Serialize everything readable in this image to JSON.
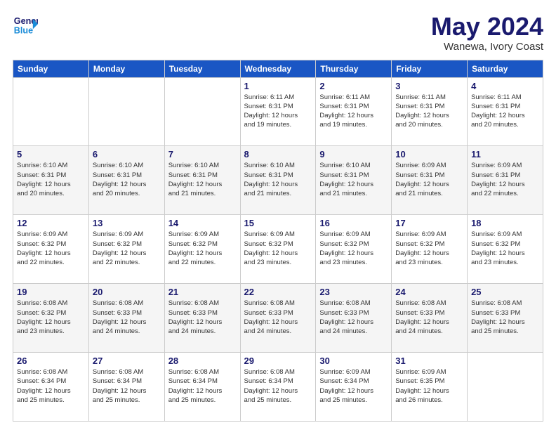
{
  "header": {
    "logo": {
      "line1": "General",
      "line2": "Blue"
    },
    "title": "May 2024",
    "location": "Wanewa, Ivory Coast"
  },
  "days_of_week": [
    "Sunday",
    "Monday",
    "Tuesday",
    "Wednesday",
    "Thursday",
    "Friday",
    "Saturday"
  ],
  "weeks": [
    [
      {
        "day": "",
        "info": ""
      },
      {
        "day": "",
        "info": ""
      },
      {
        "day": "",
        "info": ""
      },
      {
        "day": "1",
        "info": "Sunrise: 6:11 AM\nSunset: 6:31 PM\nDaylight: 12 hours\nand 19 minutes."
      },
      {
        "day": "2",
        "info": "Sunrise: 6:11 AM\nSunset: 6:31 PM\nDaylight: 12 hours\nand 19 minutes."
      },
      {
        "day": "3",
        "info": "Sunrise: 6:11 AM\nSunset: 6:31 PM\nDaylight: 12 hours\nand 20 minutes."
      },
      {
        "day": "4",
        "info": "Sunrise: 6:11 AM\nSunset: 6:31 PM\nDaylight: 12 hours\nand 20 minutes."
      }
    ],
    [
      {
        "day": "5",
        "info": "Sunrise: 6:10 AM\nSunset: 6:31 PM\nDaylight: 12 hours\nand 20 minutes."
      },
      {
        "day": "6",
        "info": "Sunrise: 6:10 AM\nSunset: 6:31 PM\nDaylight: 12 hours\nand 20 minutes."
      },
      {
        "day": "7",
        "info": "Sunrise: 6:10 AM\nSunset: 6:31 PM\nDaylight: 12 hours\nand 21 minutes."
      },
      {
        "day": "8",
        "info": "Sunrise: 6:10 AM\nSunset: 6:31 PM\nDaylight: 12 hours\nand 21 minutes."
      },
      {
        "day": "9",
        "info": "Sunrise: 6:10 AM\nSunset: 6:31 PM\nDaylight: 12 hours\nand 21 minutes."
      },
      {
        "day": "10",
        "info": "Sunrise: 6:09 AM\nSunset: 6:31 PM\nDaylight: 12 hours\nand 21 minutes."
      },
      {
        "day": "11",
        "info": "Sunrise: 6:09 AM\nSunset: 6:31 PM\nDaylight: 12 hours\nand 22 minutes."
      }
    ],
    [
      {
        "day": "12",
        "info": "Sunrise: 6:09 AM\nSunset: 6:32 PM\nDaylight: 12 hours\nand 22 minutes."
      },
      {
        "day": "13",
        "info": "Sunrise: 6:09 AM\nSunset: 6:32 PM\nDaylight: 12 hours\nand 22 minutes."
      },
      {
        "day": "14",
        "info": "Sunrise: 6:09 AM\nSunset: 6:32 PM\nDaylight: 12 hours\nand 22 minutes."
      },
      {
        "day": "15",
        "info": "Sunrise: 6:09 AM\nSunset: 6:32 PM\nDaylight: 12 hours\nand 23 minutes."
      },
      {
        "day": "16",
        "info": "Sunrise: 6:09 AM\nSunset: 6:32 PM\nDaylight: 12 hours\nand 23 minutes."
      },
      {
        "day": "17",
        "info": "Sunrise: 6:09 AM\nSunset: 6:32 PM\nDaylight: 12 hours\nand 23 minutes."
      },
      {
        "day": "18",
        "info": "Sunrise: 6:09 AM\nSunset: 6:32 PM\nDaylight: 12 hours\nand 23 minutes."
      }
    ],
    [
      {
        "day": "19",
        "info": "Sunrise: 6:08 AM\nSunset: 6:32 PM\nDaylight: 12 hours\nand 23 minutes."
      },
      {
        "day": "20",
        "info": "Sunrise: 6:08 AM\nSunset: 6:33 PM\nDaylight: 12 hours\nand 24 minutes."
      },
      {
        "day": "21",
        "info": "Sunrise: 6:08 AM\nSunset: 6:33 PM\nDaylight: 12 hours\nand 24 minutes."
      },
      {
        "day": "22",
        "info": "Sunrise: 6:08 AM\nSunset: 6:33 PM\nDaylight: 12 hours\nand 24 minutes."
      },
      {
        "day": "23",
        "info": "Sunrise: 6:08 AM\nSunset: 6:33 PM\nDaylight: 12 hours\nand 24 minutes."
      },
      {
        "day": "24",
        "info": "Sunrise: 6:08 AM\nSunset: 6:33 PM\nDaylight: 12 hours\nand 24 minutes."
      },
      {
        "day": "25",
        "info": "Sunrise: 6:08 AM\nSunset: 6:33 PM\nDaylight: 12 hours\nand 25 minutes."
      }
    ],
    [
      {
        "day": "26",
        "info": "Sunrise: 6:08 AM\nSunset: 6:34 PM\nDaylight: 12 hours\nand 25 minutes."
      },
      {
        "day": "27",
        "info": "Sunrise: 6:08 AM\nSunset: 6:34 PM\nDaylight: 12 hours\nand 25 minutes."
      },
      {
        "day": "28",
        "info": "Sunrise: 6:08 AM\nSunset: 6:34 PM\nDaylight: 12 hours\nand 25 minutes."
      },
      {
        "day": "29",
        "info": "Sunrise: 6:08 AM\nSunset: 6:34 PM\nDaylight: 12 hours\nand 25 minutes."
      },
      {
        "day": "30",
        "info": "Sunrise: 6:09 AM\nSunset: 6:34 PM\nDaylight: 12 hours\nand 25 minutes."
      },
      {
        "day": "31",
        "info": "Sunrise: 6:09 AM\nSunset: 6:35 PM\nDaylight: 12 hours\nand 26 minutes."
      },
      {
        "day": "",
        "info": ""
      }
    ]
  ]
}
